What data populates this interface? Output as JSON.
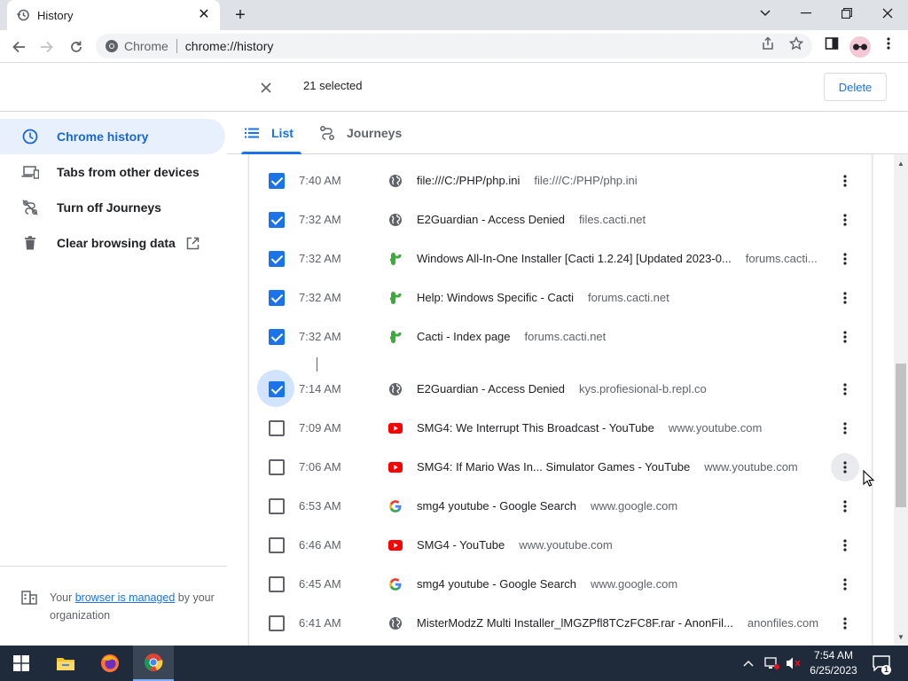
{
  "browser": {
    "tab_title": "History",
    "site_chip": "Chrome",
    "url": "chrome://history"
  },
  "selection": {
    "count_text": "21 selected",
    "delete_label": "Delete"
  },
  "sidebar": {
    "items": [
      {
        "label": "Chrome history",
        "icon": "clock-icon",
        "active": true
      },
      {
        "label": "Tabs from other devices",
        "icon": "devices-icon",
        "active": false
      },
      {
        "label": "Turn off Journeys",
        "icon": "journeys-off-icon",
        "active": false
      },
      {
        "label": "Clear browsing data",
        "icon": "trash-icon",
        "active": false
      }
    ],
    "managed": {
      "prefix": "Your ",
      "link": "browser is managed",
      "suffix": " by your organization"
    }
  },
  "view_tabs": [
    {
      "label": "List",
      "active": true
    },
    {
      "label": "Journeys",
      "active": false
    }
  ],
  "history": [
    {
      "time": "7:40 AM",
      "title": "file:///C:/PHP/php.ini",
      "domain": "file:///C:/PHP/php.ini",
      "favicon": "globe-icon",
      "checked": true
    },
    {
      "time": "7:32 AM",
      "title": "E2Guardian - Access Denied",
      "domain": "files.cacti.net",
      "favicon": "globe-icon",
      "checked": true
    },
    {
      "time": "7:32 AM",
      "title": "Windows All-In-One Installer [Cacti 1.2.24] [Updated 2023-0...",
      "domain": "forums.cacti...",
      "favicon": "cacti-icon",
      "checked": true
    },
    {
      "time": "7:32 AM",
      "title": "Help: Windows Specific - Cacti",
      "domain": "forums.cacti.net",
      "favicon": "cacti-icon",
      "checked": true
    },
    {
      "time": "7:32 AM",
      "title": "Cacti - Index page",
      "domain": "forums.cacti.net",
      "favicon": "cacti-icon",
      "checked": true
    },
    {
      "time": "7:14 AM",
      "title": "E2Guardian - Access Denied",
      "domain": "kys.profiesional-b.repl.co",
      "favicon": "globe-icon",
      "checked": true
    },
    {
      "time": "7:09 AM",
      "title": "SMG4: We Interrupt This Broadcast - YouTube",
      "domain": "www.youtube.com",
      "favicon": "youtube-icon",
      "checked": false
    },
    {
      "time": "7:06 AM",
      "title": "SMG4: If Mario Was In... Simulator Games - YouTube",
      "domain": "www.youtube.com",
      "favicon": "youtube-icon",
      "checked": false
    },
    {
      "time": "6:53 AM",
      "title": "smg4 youtube - Google Search",
      "domain": "www.google.com",
      "favicon": "google-icon",
      "checked": false
    },
    {
      "time": "6:46 AM",
      "title": "SMG4 - YouTube",
      "domain": "www.youtube.com",
      "favicon": "youtube-icon",
      "checked": false
    },
    {
      "time": "6:45 AM",
      "title": "smg4 youtube - Google Search",
      "domain": "www.google.com",
      "favicon": "google-icon",
      "checked": false
    },
    {
      "time": "6:41 AM",
      "title": "MisterModzZ Multi Installer_lMGZPfl8TCzFC8F.rar - AnonFil...",
      "domain": "anonfiles.com",
      "favicon": "globe-icon",
      "checked": false
    }
  ],
  "taskbar": {
    "time": "7:54 AM",
    "date": "6/25/2023",
    "notification_count": "1"
  },
  "colors": {
    "accent": "#1a73e8",
    "sidebar_active_bg": "#e8f0fe",
    "taskbar_bg": "#1f2a3a"
  }
}
